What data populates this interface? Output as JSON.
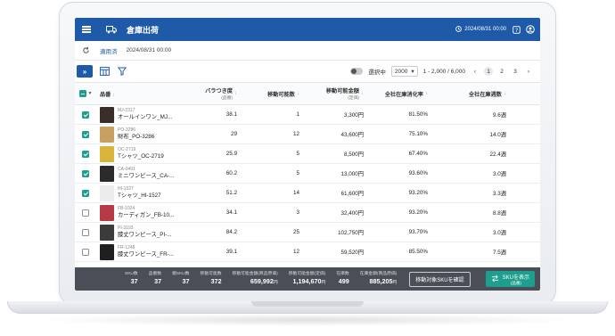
{
  "header": {
    "title": "倉庫出荷",
    "datetime": "2024/08/31 00:00"
  },
  "subbar": {
    "applied_label": "適用済",
    "applied_datetime": "2024/08/31 00:00"
  },
  "toolbar": {
    "selected_label": "選択中",
    "page_size": "2000",
    "range_text": "1 - 2,000 / 6,000",
    "pages": [
      "1",
      "2",
      "3"
    ],
    "prev": "‹",
    "next": "›"
  },
  "table": {
    "headers": {
      "name": "品番",
      "variance": "バラつき度",
      "variance_sub": "(品番)",
      "movable": "移動可能数",
      "movable_amount": "移動可能金額",
      "movable_amount_sub": "(定価)",
      "digestion": "全社在庫消化率",
      "weeks": "全社在庫週数"
    },
    "rows": [
      {
        "checked": true,
        "sku": "MJ-2317",
        "name": "オールインワン_MJ...",
        "variance": "38.1",
        "movable": "1",
        "amount": "3,300円",
        "digestion": "81.50%",
        "weeks": "9.6週",
        "thumb": "#3a2e2a"
      },
      {
        "checked": true,
        "sku": "PO-3286",
        "name": "財布_PO-3286",
        "variance": "29",
        "movable": "12",
        "amount": "43,600円",
        "digestion": "75.10%",
        "weeks": "14.0週",
        "thumb": "#c9a064"
      },
      {
        "checked": true,
        "sku": "OC-2719",
        "name": "Tシャツ_OC-2719",
        "variance": "25.9",
        "movable": "5",
        "amount": "8,500円",
        "digestion": "67.40%",
        "weeks": "22.4週",
        "thumb": "#d9b43a"
      },
      {
        "checked": true,
        "sku": "CA-0491",
        "name": "ミニワンピース_CA-...",
        "variance": "60.2",
        "movable": "5",
        "amount": "13,000円",
        "digestion": "93.60%",
        "weeks": "3.0週",
        "thumb": "#2b2b2b"
      },
      {
        "checked": true,
        "sku": "HI-1527",
        "name": "Tシャツ_HI-1527",
        "variance": "51.2",
        "movable": "14",
        "amount": "61,600円",
        "digestion": "93.20%",
        "weeks": "3.3週",
        "thumb": "#ececec"
      },
      {
        "checked": false,
        "sku": "FB-1024",
        "name": "カーディガン_FB-10...",
        "variance": "34.1",
        "movable": "3",
        "amount": "32,400円",
        "digestion": "93.20%",
        "weeks": "8.8週",
        "thumb": "#b63a45"
      },
      {
        "checked": false,
        "sku": "PI-3193",
        "name": "膝丈ワンピース_PI-...",
        "variance": "84.2",
        "movable": "25",
        "amount": "102,750円",
        "digestion": "93.70%",
        "weeks": "3.0週",
        "thumb": "#3b3b3b"
      },
      {
        "checked": false,
        "sku": "FR-1248",
        "name": "膝丈ワンピース_FR-...",
        "variance": "39.1",
        "movable": "12",
        "amount": "59,520円",
        "digestion": "85.50%",
        "weeks": "7.5週",
        "thumb": "#1f1f1f"
      }
    ]
  },
  "footer": {
    "stats": [
      {
        "label": "SKU数",
        "value": "37",
        "unit": ""
      },
      {
        "label": "品番数",
        "value": "37",
        "unit": ""
      },
      {
        "label": "親SKU数",
        "value": "37",
        "unit": ""
      },
      {
        "label": "移動可能数",
        "value": "372",
        "unit": ""
      },
      {
        "label": "移動可能金額(商品原価)",
        "value": "659,992",
        "unit": "円"
      },
      {
        "label": "移動可能金額(定価)",
        "value": "1,194,670",
        "unit": "円"
      },
      {
        "label": "在庫数",
        "value": "499",
        "unit": ""
      },
      {
        "label": "在庫金額(商品原価)",
        "value": "885,205",
        "unit": "円"
      }
    ],
    "confirm_button": "移動対象SKUを確認",
    "show_button": "SKUを表示",
    "show_button_sub": "(品番)"
  },
  "colors": {
    "header_bg": "#1f5aa8",
    "accent": "#1e9e8f",
    "footer_bg": "#4a4f57"
  }
}
